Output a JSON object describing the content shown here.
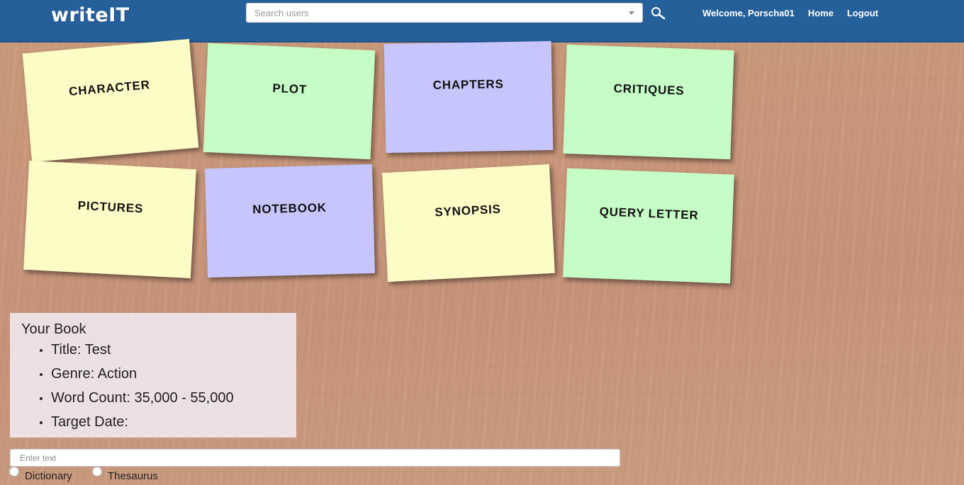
{
  "header": {
    "brand": "writeIT",
    "search_placeholder": "Search users",
    "welcome": "Welcome, Porscha01",
    "home": "Home",
    "logout": "Logout"
  },
  "notes": [
    {
      "label": "CHARACTER",
      "color": "#fefcc6"
    },
    {
      "label": "PLOT",
      "color": "#c6fcc6"
    },
    {
      "label": "CHAPTERS",
      "color": "#c6c5fc"
    },
    {
      "label": "CRITIQUES",
      "color": "#c6fcc6"
    },
    {
      "label": "PICTURES",
      "color": "#fefcc6"
    },
    {
      "label": "NOTEBOOK",
      "color": "#c6c5fc"
    },
    {
      "label": "SYNOPSIS",
      "color": "#fefcc6"
    },
    {
      "label": "QUERY LETTER",
      "color": "#c6fcc6"
    }
  ],
  "book": {
    "heading": "Your Book",
    "items": [
      "Title: Test",
      "Genre: Action",
      "Word Count: 35,000 - 55,000",
      "Target Date:"
    ]
  },
  "lookup": {
    "placeholder": "Enter text",
    "options": [
      "Dictionary",
      "Thesaurus"
    ]
  },
  "colors": {
    "navbar": "#25609b",
    "yellow_note": "#fefcc6",
    "green_note": "#c6fcc6",
    "purple_note": "#c6c5fc"
  },
  "icons": {
    "search": "magnifier-icon",
    "dropdown": "caret-down-icon"
  }
}
